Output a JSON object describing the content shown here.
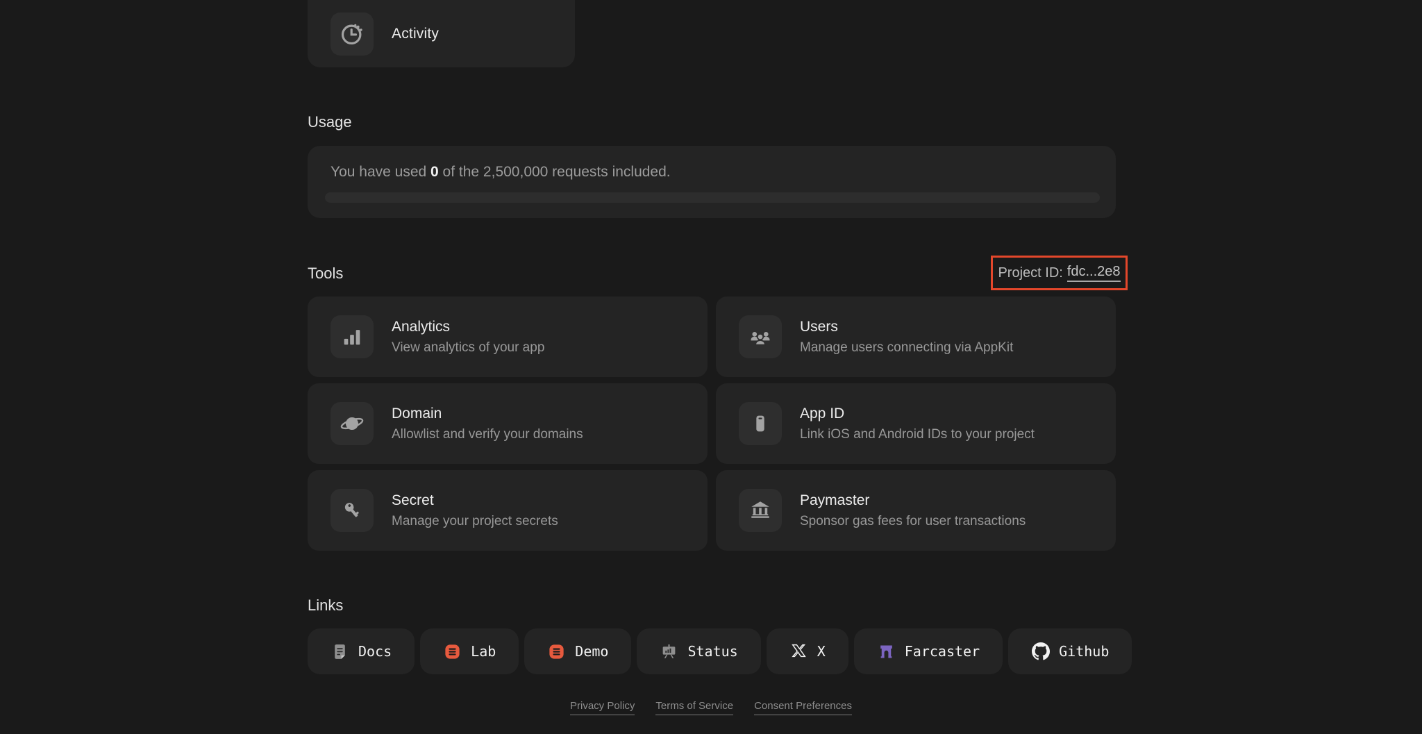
{
  "activity_card": {
    "label": "Activity",
    "icon": "activity-clock-icon"
  },
  "usage": {
    "heading": "Usage",
    "text_prefix": "You have used ",
    "used_value": "0",
    "text_suffix": " of the 2,500,000 requests included.",
    "progress_percent": 0
  },
  "tools": {
    "heading": "Tools",
    "project_id": {
      "label": "Project ID:",
      "value": "fdc...2e8"
    },
    "cards": [
      {
        "title": "Analytics",
        "description": "View analytics of your app",
        "icon": "bar-chart-icon"
      },
      {
        "title": "Users",
        "description": "Manage users connecting via AppKit",
        "icon": "users-group-icon"
      },
      {
        "title": "Domain",
        "description": "Allowlist and verify your domains",
        "icon": "planet-icon"
      },
      {
        "title": "App ID",
        "description": "Link iOS and Android IDs to your project",
        "icon": "mobile-phone-icon"
      },
      {
        "title": "Secret",
        "description": "Manage your project secrets",
        "icon": "key-icon"
      },
      {
        "title": "Paymaster",
        "description": "Sponsor gas fees for user transactions",
        "icon": "bank-icon"
      }
    ]
  },
  "links": {
    "heading": "Links",
    "items": [
      {
        "label": "Docs",
        "icon": "docs-document-icon"
      },
      {
        "label": "Lab",
        "icon": "lab-orange-list-icon"
      },
      {
        "label": "Demo",
        "icon": "demo-orange-list-icon"
      },
      {
        "label": "Status",
        "icon": "status-board-icon"
      },
      {
        "label": "X",
        "icon": "x-logo-icon"
      },
      {
        "label": "Farcaster",
        "icon": "farcaster-arch-icon"
      },
      {
        "label": "Github",
        "icon": "github-octocat-icon"
      }
    ]
  },
  "footer": {
    "links": [
      "Privacy Policy",
      "Terms of Service",
      "Consent Preferences"
    ]
  },
  "colors": {
    "background": "#1a1a1a",
    "card": "#242424",
    "icon_tile": "#2e2e2e",
    "title_text": "#ececec",
    "muted_text": "#989898",
    "annotation_red": "#e3472b",
    "lab_demo_orange": "#e75a3e",
    "farcaster_purple": "#7c65c1",
    "progress_track": "#2d2d2d"
  }
}
